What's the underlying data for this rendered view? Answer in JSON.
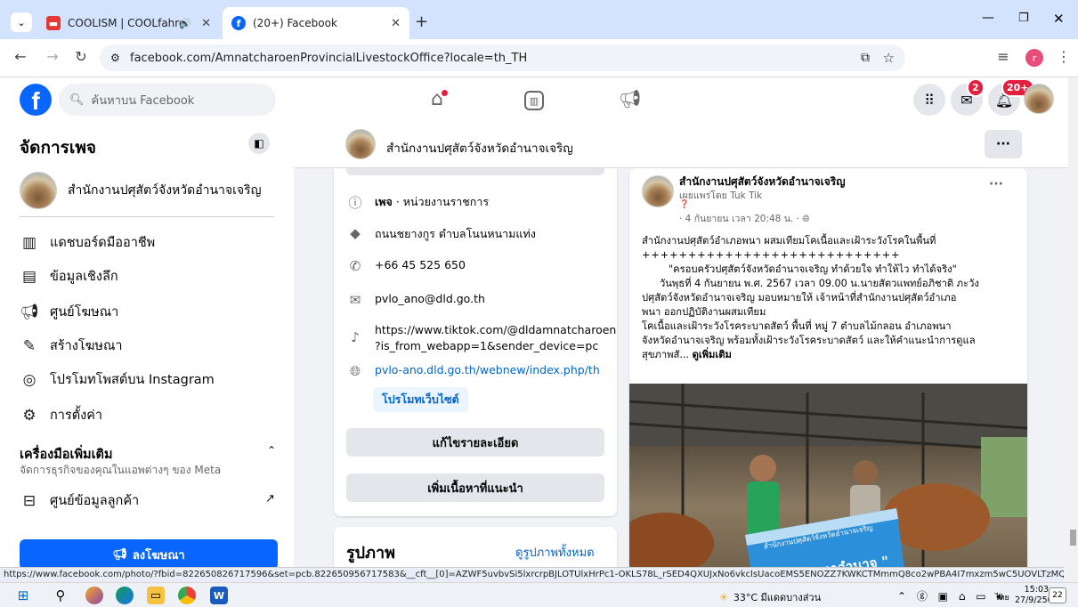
{
  "browser": {
    "tabs": [
      {
        "label": "COOLISM | COOLfahrenhei",
        "active": false
      },
      {
        "label": "(20+) Facebook",
        "active": true
      }
    ],
    "new_tab": "+",
    "url": "facebook.com/AmnatcharoenProvincialLivestockOffice?locale=th_TH",
    "profile_letter": "r"
  },
  "fb_header": {
    "search_placeholder": "ค้นหาบน Facebook",
    "messenger_badge": "2",
    "notif_badge": "20+"
  },
  "sidebar": {
    "title": "จัดการเพจ",
    "page_name": "สำนักงานปศุสัตว์จังหวัดอำนาจเจริญ",
    "items": [
      {
        "label": "แดชบอร์ดมืออาชีพ",
        "icon": "dashboard-icon"
      },
      {
        "label": "ข้อมูลเชิงลึก",
        "icon": "insights-icon"
      },
      {
        "label": "ศูนย์โฆษณา",
        "icon": "megaphone-icon"
      },
      {
        "label": "สร้างโฆษณา",
        "icon": "pencil-icon"
      },
      {
        "label": "โปรโมทโพสต์บน Instagram",
        "icon": "instagram-icon"
      },
      {
        "label": "การตั้งค่า",
        "icon": "gear-icon"
      }
    ],
    "tools_title": "เครื่องมือเพิ่มเติม",
    "tools_subtitle": "จัดการธุรกิจของคุณในแอพต่างๆ ของ Meta",
    "tools_item": "ศูนย์ข้อมูลลูกค้า",
    "promote_button": "ลงโฆษณา"
  },
  "pagebar": {
    "name": "สำนักงานปศุสัตว์จังหวัดอำนาจเจริญ",
    "more": "···"
  },
  "intro": {
    "category_prefix": "เพจ",
    "category": "· หน่วยงานราชการ",
    "address": "ถนนชยางกูร ตำบลโนนหนามแท่ง",
    "phone": "+66 45 525 650",
    "email": "pvlo_ano@dld.go.th",
    "tiktok_line1": "https://www.tiktok.com/@dldamnatcharoen",
    "tiktok_line2": "?is_from_webapp=1&sender_device=pc",
    "website": "pvlo-ano.dld.go.th/webnew/index.php/th",
    "promote_site": "โปรโมทเว็บไซต์",
    "edit_details": "แก้ไขรายละเอียด",
    "add_featured": "เพิ่มเนื้อหาที่แนะนำ"
  },
  "photos": {
    "title": "รูปภาพ",
    "see_all": "ดูรูปภาพทั้งหมด"
  },
  "post": {
    "author": "สำนักงานปศุสัตว์จังหวัดอำนาจเจริญ",
    "published_by": "เผยแพร่โดย Tuk Tik",
    "time": "· 4 กันยายน เวลา 20:48 น. ·",
    "menu": "···",
    "line1": "สำนักงานปศุสัตว์อำเภอพนา ผสมเทียมโคเนื้อและเฝ้าระวังโรคในพื้นที่",
    "line2": "++++++++++++++++++++++++++++",
    "line3": "\"ครอบครัวปศุสัตว์จังหวัดอำนาจเจริญ ทำด้วยใจ ทำให้ไว ทำได้จริง\"",
    "line4": "วันพุธที่ 4 กันยายน พ.ศ. 2567 เวลา 09.00 น.นายสัตวแพทย์อภิชาติ ภะวัง",
    "line5": "ปศุสัตว์จังหวัดอำนาจเจริญ มอบหมายให้ เจ้าหน้าที่สำนักงานปศุสัตว์อำเภอ",
    "line6": "พนา ออกปฏิบัติงานผสมเทียม",
    "line7": "โคเนื้อและเฝ้าระวังโรคระบาดสัตว์ พื้นที่ หมู่ 7 ตำบลไม้กลอน อำเภอพนา",
    "line8": "จังหวัดอำนาจเจริญ พร้อมทั้งเฝ้าระวังโรคระบาดสัตว์ และให้คำแนะนำการดูแล",
    "line9": "สุขภาพสั...",
    "see_more": "ดูเพิ่มเติม",
    "banner_text": "\" แดงมหาอำนาจ \"",
    "banner_small": "สำนักงานปศุสัตว์จังหวัดอำนาจเจริญ"
  },
  "status_url": "https://www.facebook.com/photo/?fbid=822650826717596&set=pcb.822650956717583&__cft__[0]=AZWF5uvbvSi5lxrcrpBJLOTUlxHrPc1-OKLS78L_rSED4QXUJxNo6vkclsUacoEMS5ENOZZ7KWKCTMmmQ8co2wPBA4I7mxzm5wC5UOVLTzMQ1Uw6KSh...",
  "taskbar": {
    "weather": "33°C มีแดดบางส่วน",
    "lang": "ไทย",
    "time": "15:03",
    "date": "27/9/2567",
    "notif": "22"
  },
  "colors": {
    "fb_blue": "#0866ff",
    "badge_red": "#e41e3f"
  }
}
